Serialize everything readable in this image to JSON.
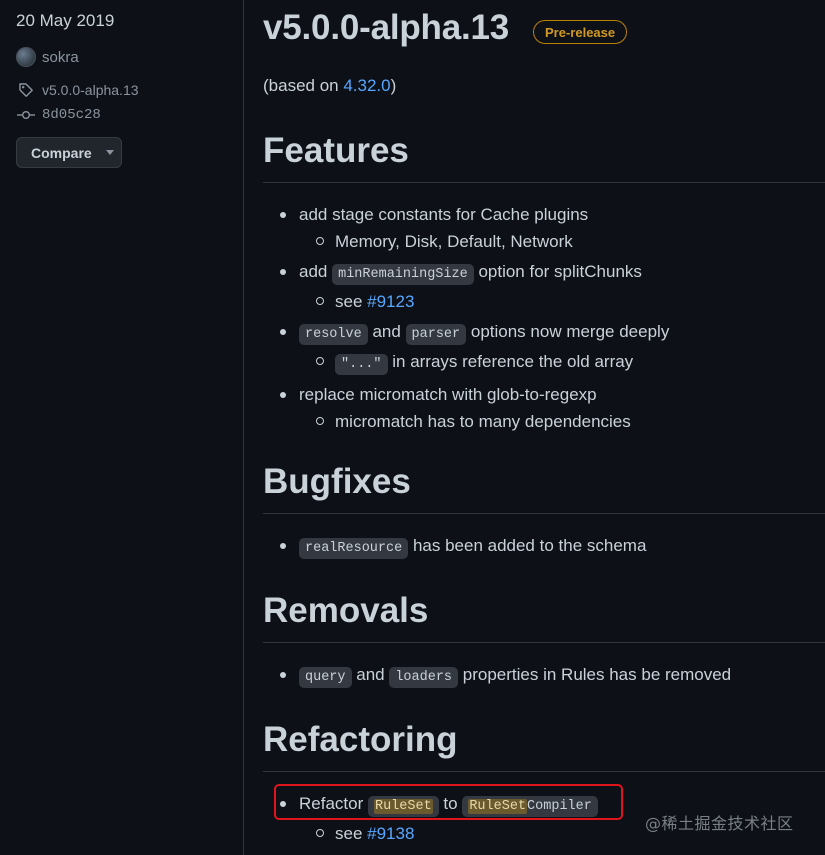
{
  "sidebar": {
    "date": "20 May 2019",
    "author": "sokra",
    "tag": "v5.0.0-alpha.13",
    "commit": "8d05c28",
    "compare_label": "Compare"
  },
  "release": {
    "title": "v5.0.0-alpha.13",
    "badge": "Pre-release",
    "based_prefix": "(based on ",
    "based_link": "4.32.0",
    "based_suffix": ")"
  },
  "sections": {
    "features": {
      "heading": "Features",
      "item1": "add stage constants for Cache plugins",
      "item1_sub": "Memory, Disk, Default, Network",
      "item2_pre": "add ",
      "item2_code": "minRemainingSize",
      "item2_post": " option for splitChunks",
      "item2_sub_pre": "see ",
      "item2_sub_link": "#9123",
      "item3_code1": "resolve",
      "item3_mid": " and ",
      "item3_code2": "parser",
      "item3_post": " options now merge deeply",
      "item3_sub_code": "\"...\"",
      "item3_sub_post": " in arrays reference the old array",
      "item4": "replace micromatch with glob-to-regexp",
      "item4_sub": "micromatch has to many dependencies"
    },
    "bugfixes": {
      "heading": "Bugfixes",
      "item1_code": "realResource",
      "item1_post": " has been added to the schema"
    },
    "removals": {
      "heading": "Removals",
      "item1_code1": "query",
      "item1_mid": " and ",
      "item1_code2": "loaders",
      "item1_post": " properties in Rules has be removed"
    },
    "refactoring": {
      "heading": "Refactoring",
      "item1_pre": "Refactor ",
      "item1_code1": "RuleSet",
      "item1_mid": " to ",
      "item1_code2_hl": "RuleSet",
      "item1_code2_rest": "Compiler",
      "item1_sub_pre": "see ",
      "item1_sub_link": "#9138"
    }
  },
  "watermark": "@稀土掘金技术社区",
  "colors": {
    "background": "#0d1117",
    "text": "#c9d1d9",
    "link": "#58a6ff",
    "badge": "#d29922",
    "annotation_box": "#e0141b"
  }
}
